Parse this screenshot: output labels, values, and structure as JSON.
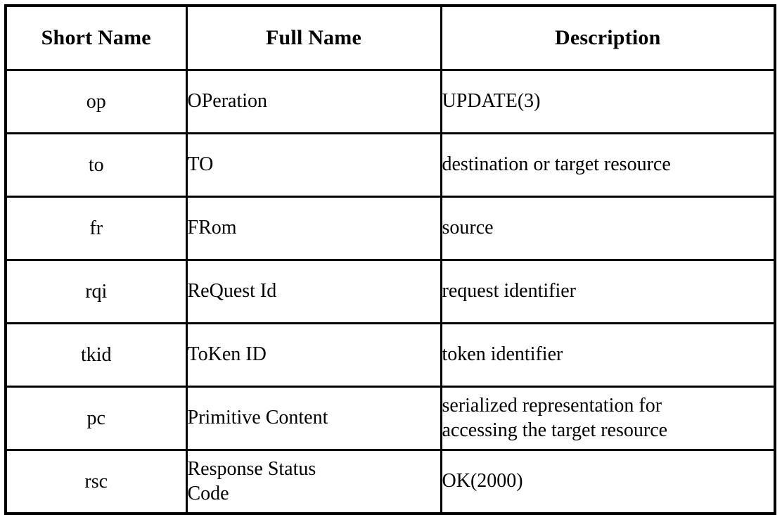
{
  "table": {
    "caption_present": false,
    "columns": [
      "Short Name",
      "Full Name",
      "Description"
    ],
    "rows": [
      {
        "short_name": "op",
        "full_name": "OPeration",
        "full_name_lines": [
          "OPeration"
        ],
        "description": "UPDATE(3)",
        "description_lines": [
          "UPDATE(3)"
        ]
      },
      {
        "short_name": "to",
        "full_name": "TO",
        "full_name_lines": [
          "TO"
        ],
        "description": "destination or target resource",
        "description_lines": [
          "destination or target resource"
        ]
      },
      {
        "short_name": "fr",
        "full_name": "FRom",
        "full_name_lines": [
          "FRom"
        ],
        "description": "source",
        "description_lines": [
          "source"
        ]
      },
      {
        "short_name": "rqi",
        "full_name": "ReQuest Id",
        "full_name_lines": [
          "ReQuest Id"
        ],
        "description": "request identifier",
        "description_lines": [
          "request identifier"
        ]
      },
      {
        "short_name": "tkid",
        "full_name": "ToKen ID",
        "full_name_lines": [
          "ToKen ID"
        ],
        "description": "token identifier",
        "description_lines": [
          "token identifier"
        ]
      },
      {
        "short_name": "pc",
        "full_name": "Primitive Content",
        "full_name_lines": [
          "Primitive Content"
        ],
        "description": "serialized representation for accessing the target resource",
        "description_lines": [
          "serialized representation for",
          "accessing the target resource"
        ]
      },
      {
        "short_name": "rsc",
        "full_name": "Response Status Code",
        "full_name_lines": [
          "Response Status",
          "Code"
        ],
        "description": "OK(2000)",
        "description_lines": [
          "OK(2000)"
        ]
      }
    ]
  },
  "style": {
    "border_color": "#000000",
    "text_color": "#000000",
    "background_color": "#ffffff"
  }
}
